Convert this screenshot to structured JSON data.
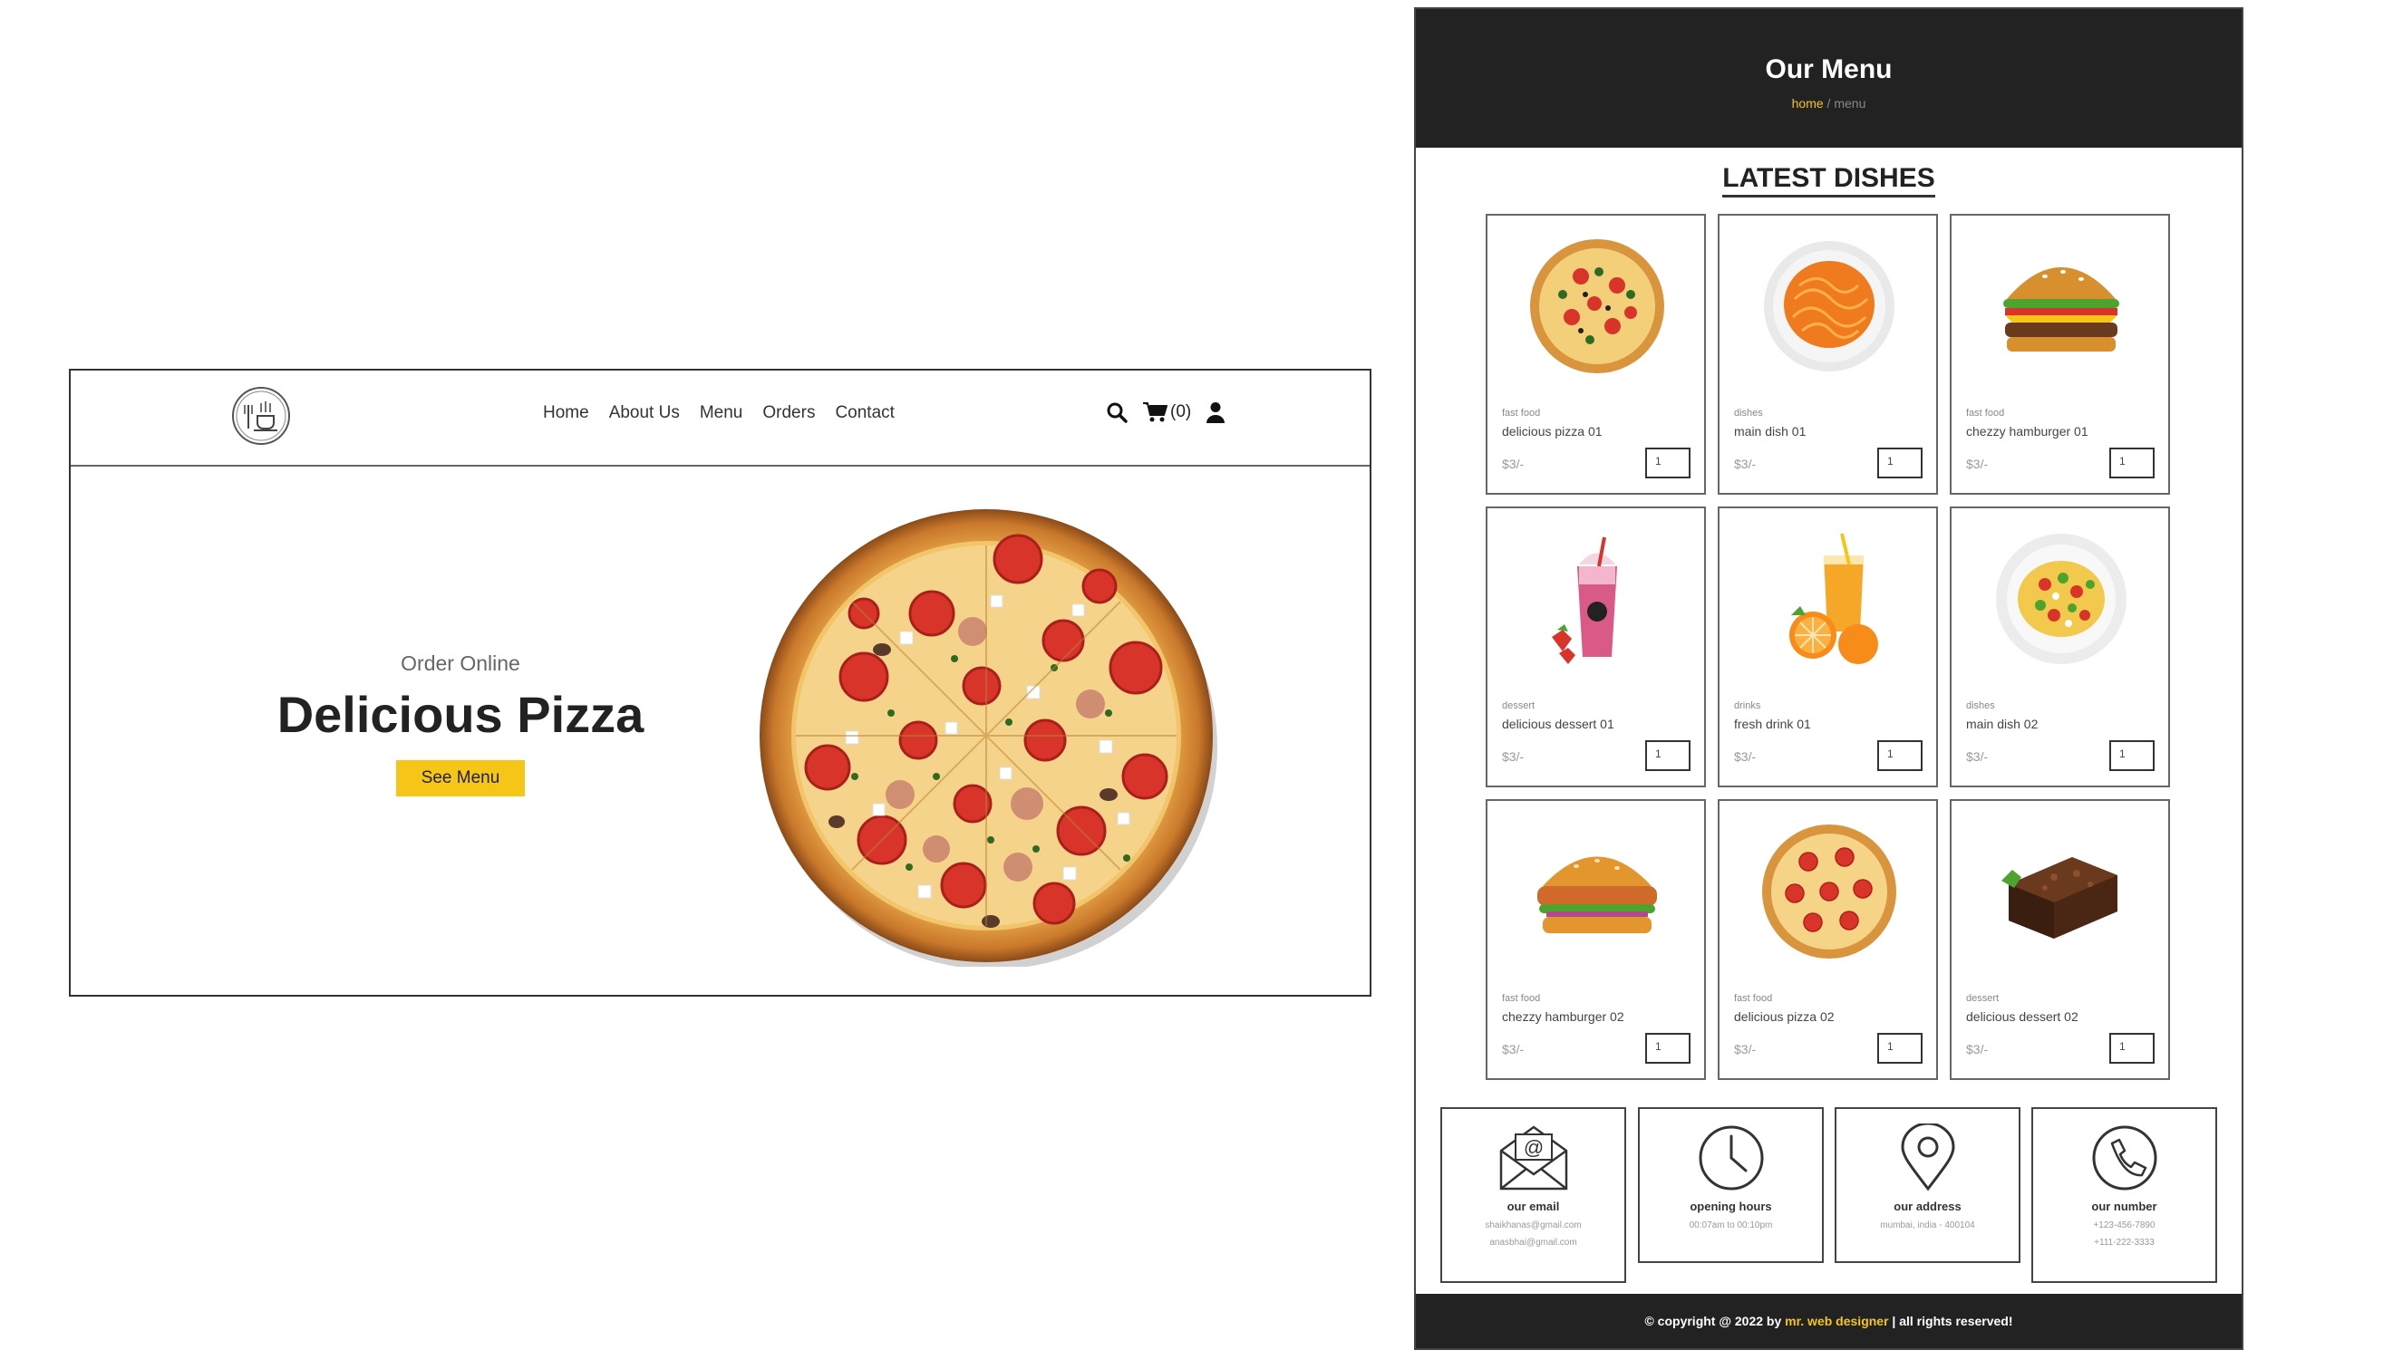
{
  "home": {
    "logo": "restaurant-logo-icon",
    "nav": [
      "Home",
      "About Us",
      "Menu",
      "Orders",
      "Contact"
    ],
    "cart_count": "(0)",
    "hero": {
      "subtitle": "Order Online",
      "title": "Delicious Pizza",
      "button": "See Menu"
    },
    "icons": [
      "search-icon",
      "cart-icon",
      "user-icon"
    ]
  },
  "menu": {
    "title": "Our Menu",
    "breadcrumb": {
      "home": "home",
      "separator": " / ",
      "current": "menu"
    },
    "section_title": "LATEST DISHES",
    "dishes": [
      {
        "category": "fast food",
        "name": "delicious pizza 01",
        "price": "$3/-",
        "qty": "1",
        "image": "pizza"
      },
      {
        "category": "dishes",
        "name": "main dish 01",
        "price": "$3/-",
        "qty": "1",
        "image": "noodles"
      },
      {
        "category": "fast food",
        "name": "chezzy hamburger 01",
        "price": "$3/-",
        "qty": "1",
        "image": "burger"
      },
      {
        "category": "dessert",
        "name": "delicious dessert 01",
        "price": "$3/-",
        "qty": "1",
        "image": "milkshake"
      },
      {
        "category": "drinks",
        "name": "fresh drink 01",
        "price": "$3/-",
        "qty": "1",
        "image": "orange-juice"
      },
      {
        "category": "dishes",
        "name": "main dish 02",
        "price": "$3/-",
        "qty": "1",
        "image": "salad"
      },
      {
        "category": "fast food",
        "name": "chezzy hamburger 02",
        "price": "$3/-",
        "qty": "1",
        "image": "chicken-burger"
      },
      {
        "category": "fast food",
        "name": "delicious pizza 02",
        "price": "$3/-",
        "qty": "1",
        "image": "pizza"
      },
      {
        "category": "dessert",
        "name": "delicious dessert 02",
        "price": "$3/-",
        "qty": "1",
        "image": "brownie"
      }
    ],
    "info": [
      {
        "icon": "email-icon",
        "title": "our email",
        "lines": [
          "shaikhanas@gmail.com",
          "anasbhai@gmail.com"
        ]
      },
      {
        "icon": "clock-icon",
        "title": "opening hours",
        "lines": [
          "00:07am to 00:10pm"
        ]
      },
      {
        "icon": "location-pin-icon",
        "title": "our address",
        "lines": [
          "mumbai, india - 400104"
        ]
      },
      {
        "icon": "phone-icon",
        "title": "our number",
        "lines": [
          "+123-456-7890",
          "+111-222-3333"
        ]
      }
    ],
    "footer": {
      "prefix": "© copyright @ 2022 by ",
      "highlight": "mr. web designer",
      "suffix": " | all rights reserved!"
    }
  },
  "colors": {
    "accent": "#f5c518",
    "dark": "#222222"
  }
}
